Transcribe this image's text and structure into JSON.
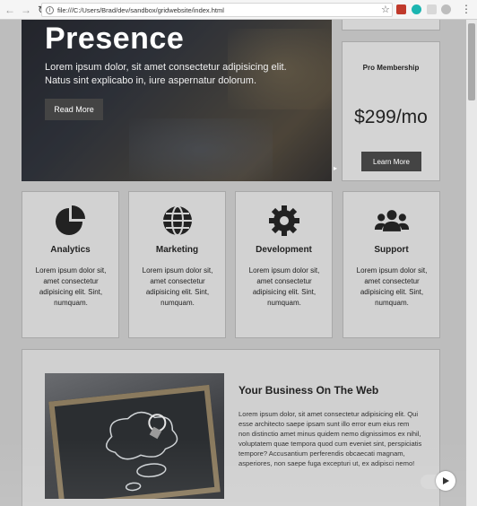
{
  "browser": {
    "url": "file:///C:/Users/Brad/dev/sandbox/gridwebsite/index.html",
    "back_icon": "back-arrow-icon",
    "forward_icon": "forward-arrow-icon",
    "reload_icon": "reload-icon"
  },
  "showcase": {
    "heading": "Presence",
    "text": "Lorem ipsum dolor, sit amet consectetur adipisicing elit. Natus sint explicabo in, iure aspernatur dolorum.",
    "button": "Read More"
  },
  "pro": {
    "title": "Pro Membership",
    "price": "$299/mo",
    "button": "Learn More"
  },
  "cards": [
    {
      "icon": "pie-chart-icon",
      "title": "Analytics",
      "text": "Lorem ipsum dolor sit, amet consectetur adipisicing elit. Sint, numquam."
    },
    {
      "icon": "globe-icon",
      "title": "Marketing",
      "text": "Lorem ipsum dolor sit, amet consectetur adipisicing elit. Sint, numquam."
    },
    {
      "icon": "cog-icon",
      "title": "Development",
      "text": "Lorem ipsum dolor sit, amet consectetur adipisicing elit. Sint, numquam."
    },
    {
      "icon": "users-icon",
      "title": "Support",
      "text": "Lorem ipsum dolor sit, amet consectetur adipisicing elit. Sint, numquam."
    }
  ],
  "business": {
    "heading": "Your Business On The Web",
    "text": "Lorem ipsum dolor, sit amet consectetur adipisicing elit. Qui esse architecto saepe ipsam sunt illo error eum eius rem non distinctio amet minus quidem nemo dignissimos ex nihil, voluptatem quae tempora quod cum eveniet sint, perspiciatis tempore? Accusantium perferendis obcaecati magnam, asperiores, non saepe fuga excepturi ut, ex adipisci nemo!"
  },
  "colors": {
    "button_bg": "#444444",
    "card_bg": "#d2d2d2"
  }
}
